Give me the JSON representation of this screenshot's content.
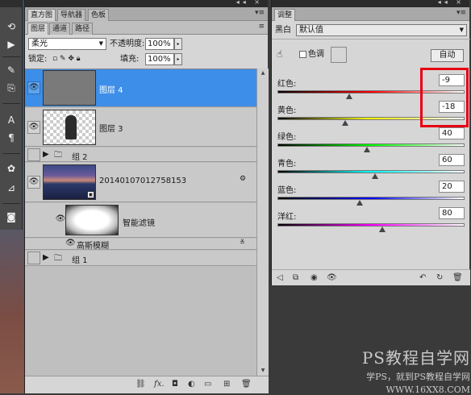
{
  "layers_panel": {
    "tabs": [
      "直方图",
      "导航器",
      "色板"
    ],
    "sub_tabs": [
      "图层",
      "通道",
      "路径"
    ],
    "blend_mode": "柔光",
    "opacity_label": "不透明度:",
    "opacity_value": "100%",
    "lock_label": "锁定:",
    "fill_label": "填充:",
    "fill_value": "100%",
    "layers": [
      {
        "name": "图层 4",
        "selected": true
      },
      {
        "name": "图层 3",
        "selected": false
      },
      {
        "name": "组 2",
        "selected": false
      },
      {
        "name": "20140107012758153",
        "selected": false
      },
      {
        "name": "智能滤镜",
        "selected": false
      },
      {
        "name": "高斯模糊",
        "selected": false
      },
      {
        "name": "组 1",
        "selected": false
      }
    ]
  },
  "adjust_panel": {
    "tab": "调整",
    "type": "黑白",
    "preset": "默认值",
    "tint_label": "色调",
    "auto_button": "自动",
    "sliders": [
      {
        "name": "红色:",
        "value": "-9",
        "level": -9,
        "colors": [
          "#ff0000",
          "#ffffff"
        ]
      },
      {
        "name": "黄色:",
        "value": "-18",
        "level": -18,
        "colors": [
          "#ffff00",
          "#ffffff"
        ]
      },
      {
        "name": "绿色:",
        "value": "40",
        "level": 40,
        "colors": [
          "#00ff00",
          "#ffffff"
        ]
      },
      {
        "name": "青色:",
        "value": "60",
        "level": 60,
        "colors": [
          "#00ffff",
          "#ffffff"
        ]
      },
      {
        "name": "蓝色:",
        "value": "20",
        "level": 20,
        "colors": [
          "#0000ff",
          "#ffffff"
        ]
      },
      {
        "name": "洋红:",
        "value": "80",
        "level": 80,
        "colors": [
          "#ff00ff",
          "#ffffff"
        ]
      }
    ]
  },
  "watermark": {
    "title": "PS教程自学网",
    "subtitle1": "学PS，就到PS教程自学网",
    "subtitle2": "WWW.16XX8.COM"
  },
  "colors": {
    "selected": "#3d8ee9",
    "highlight": "#e60012"
  }
}
